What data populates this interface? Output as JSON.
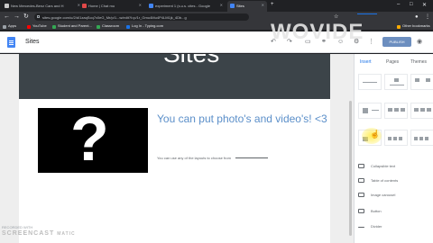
{
  "browser": {
    "tabs": [
      {
        "title": "New Mercedes-Benz Cars and H",
        "color": "#c9c9c9"
      },
      {
        "title": "Home | Chat mo",
        "color": "#e04848"
      },
      {
        "title": "experiment 1 (s.u.s. cites - Google",
        "color": "#4285f4"
      },
      {
        "title": "Sites",
        "color": "#4285f4"
      }
    ],
    "url": "sites.google.com/u/2/d/1zaqScq7x0eG_Mr/p/1...w/edit?l=p/1r_Gmu4Mu4P4LM1jk_4Db...g",
    "bookmarks": [
      {
        "label": "Apps",
        "color": "#5f6368"
      },
      {
        "label": "YouTube",
        "color": "#ff0000"
      },
      {
        "label": "Student and Parent...",
        "color": "#34a853"
      },
      {
        "label": "Classroom",
        "color": "#34a853"
      },
      {
        "label": "Log In - Typing.com",
        "color": "#1a73e8"
      }
    ],
    "other_bookmarks": "Other bookmarks"
  },
  "app": {
    "title": "Sites",
    "publish_label": "PUBLISH",
    "watermark_logo": "WOVIDE"
  },
  "page": {
    "hero_title": "Sites",
    "card_heading": "You can put photo's and video's! <3",
    "card_subtext": "You can use any of the layouts to choose from",
    "placeholder_glyph": "?"
  },
  "panel": {
    "tabs": [
      "Insert",
      "Pages",
      "Themes"
    ],
    "items": [
      "Collapsible text",
      "Table of contents",
      "Image carousel",
      "Button",
      "Divider"
    ]
  },
  "recording": {
    "line1": "RECORDED WITH",
    "line2": "SCREENCAST",
    "line3": "MATIC"
  }
}
